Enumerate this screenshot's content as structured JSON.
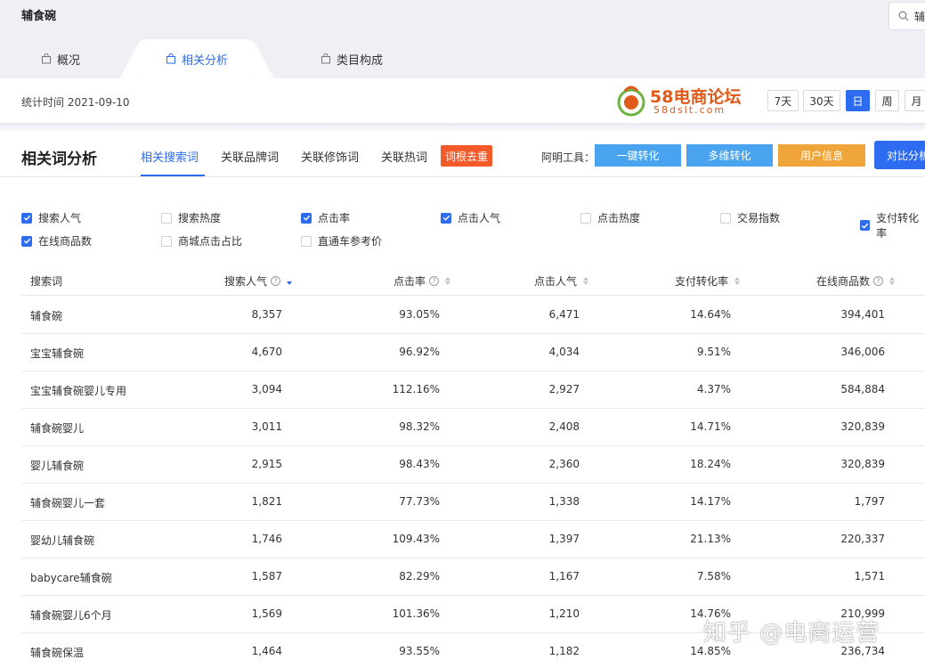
{
  "header": {
    "title": "辅食碗",
    "search_text": "辅"
  },
  "tabs": [
    {
      "label": "概况"
    },
    {
      "label": "相关分析"
    },
    {
      "label": "类目构成"
    }
  ],
  "stat": {
    "time_label": "统计时间 2021-09-10"
  },
  "logo": {
    "brand": "58电商论坛",
    "sub": "58dslt.com"
  },
  "ranges": [
    "7天",
    "30天",
    "日",
    "周",
    "月"
  ],
  "section": {
    "title": "相关词分析",
    "sub_tabs": [
      "相关搜索词",
      "关联品牌词",
      "关联修饰词",
      "关联热词"
    ],
    "root_button": "词根去重",
    "tools_label": "阿明工具：",
    "tool_buttons": [
      "一键转化",
      "多维转化",
      "用户信息"
    ],
    "compare_button": "对比分析"
  },
  "colors": {
    "accent": "#2d6cf0",
    "orange": "#f25a29",
    "tool_blue": "#4aa3ee",
    "tool_orange": "#f0a53a"
  },
  "checkboxes": [
    {
      "label": "搜索人气",
      "checked": true
    },
    {
      "label": "搜索热度",
      "checked": false
    },
    {
      "label": "点击率",
      "checked": true
    },
    {
      "label": "点击人气",
      "checked": true
    },
    {
      "label": "点击热度",
      "checked": false
    },
    {
      "label": "交易指数",
      "checked": false
    },
    {
      "label": "支付转化率",
      "checked": true
    },
    {
      "label": "在线商品数",
      "checked": true
    },
    {
      "label": "商城点击占比",
      "checked": false
    },
    {
      "label": "直通车参考价",
      "checked": false
    }
  ],
  "table": {
    "columns": [
      "搜索词",
      "搜索人气",
      "点击率",
      "点击人气",
      "支付转化率",
      "在线商品数"
    ],
    "rows": [
      [
        "辅食碗",
        "8,357",
        "93.05%",
        "6,471",
        "14.64%",
        "394,401"
      ],
      [
        "宝宝辅食碗",
        "4,670",
        "96.92%",
        "4,034",
        "9.51%",
        "346,006"
      ],
      [
        "宝宝辅食碗婴儿专用",
        "3,094",
        "112.16%",
        "2,927",
        "4.37%",
        "584,884"
      ],
      [
        "辅食碗婴儿",
        "3,011",
        "98.32%",
        "2,408",
        "14.71%",
        "320,839"
      ],
      [
        "婴儿辅食碗",
        "2,915",
        "98.43%",
        "2,360",
        "18.24%",
        "320,839"
      ],
      [
        "辅食碗婴儿一套",
        "1,821",
        "77.73%",
        "1,338",
        "14.17%",
        "1,797"
      ],
      [
        "婴幼儿辅食碗",
        "1,746",
        "109.43%",
        "1,397",
        "21.13%",
        "220,337"
      ],
      [
        "babycare辅食碗",
        "1,587",
        "82.29%",
        "1,167",
        "7.58%",
        "1,571"
      ],
      [
        "辅食碗婴儿6个月",
        "1,569",
        "101.36%",
        "1,210",
        "14.76%",
        "210,999"
      ],
      [
        "辅食碗保温",
        "1,464",
        "93.55%",
        "1,182",
        "14.85%",
        "236,734"
      ]
    ]
  },
  "watermark": "知乎 @电商运营"
}
